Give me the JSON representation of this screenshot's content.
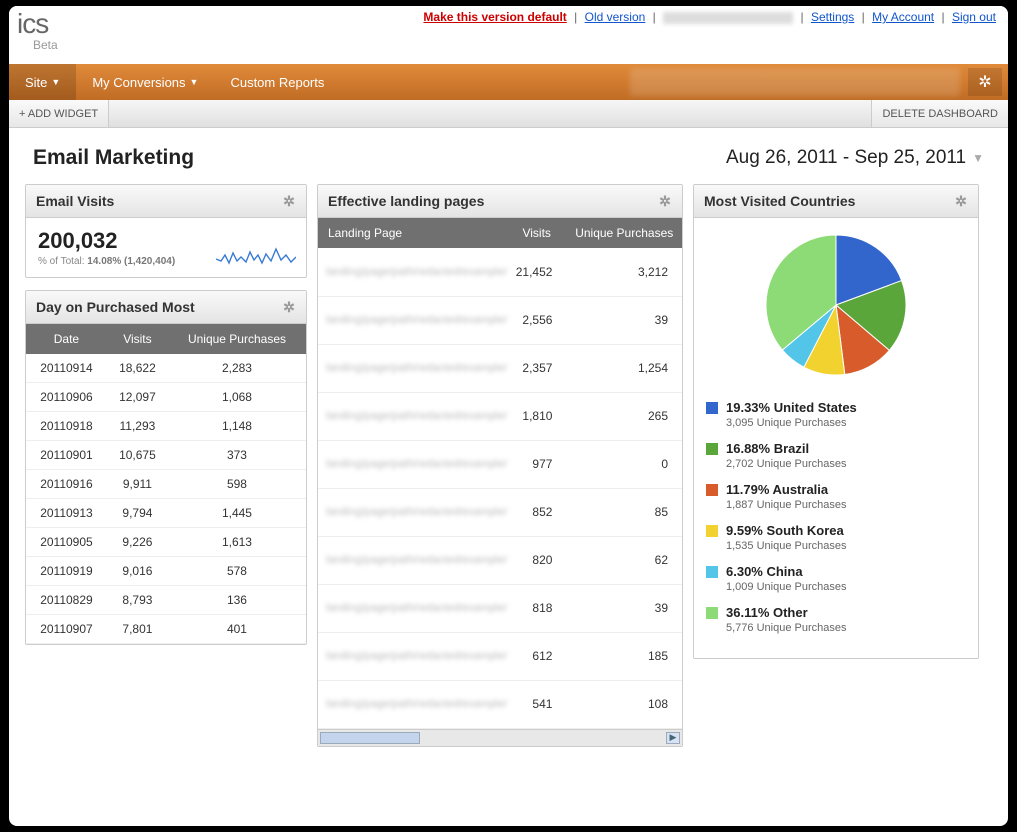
{
  "brand": {
    "suffix": "ics",
    "sub": "Beta"
  },
  "toplinks": {
    "default": "Make this version default",
    "old": "Old version",
    "settings": "Settings",
    "account": "My Account",
    "signout": "Sign out"
  },
  "nav": {
    "items": [
      {
        "label": "Site"
      },
      {
        "label": "My Conversions"
      },
      {
        "label": "Custom Reports"
      }
    ]
  },
  "toolbar": {
    "add": "+ ADD WIDGET",
    "delete": "DELETE DASHBOARD"
  },
  "page": {
    "title": "Email Marketing",
    "daterange": "Aug 26, 2011 - Sep 25, 2011"
  },
  "widgets": {
    "emailVisits": {
      "title": "Email Visits",
      "value": "200,032",
      "sub_prefix": "% of Total:",
      "sub_pct": "14.08%",
      "sub_total": "(1,420,404)"
    },
    "dayPurchased": {
      "title": "Day on Purchased Most",
      "cols": [
        "Date",
        "Visits",
        "Unique Purchases"
      ],
      "rows": [
        [
          "20110914",
          "18,622",
          "2,283"
        ],
        [
          "20110906",
          "12,097",
          "1,068"
        ],
        [
          "20110918",
          "11,293",
          "1,148"
        ],
        [
          "20110901",
          "10,675",
          "373"
        ],
        [
          "20110916",
          "9,911",
          "598"
        ],
        [
          "20110913",
          "9,794",
          "1,445"
        ],
        [
          "20110905",
          "9,226",
          "1,613"
        ],
        [
          "20110919",
          "9,016",
          "578"
        ],
        [
          "20110829",
          "8,793",
          "136"
        ],
        [
          "20110907",
          "7,801",
          "401"
        ]
      ]
    },
    "landing": {
      "title": "Effective landing pages",
      "cols": [
        "Landing Page",
        "Visits",
        "Unique Purchases"
      ],
      "rows": [
        [
          "",
          "21,452",
          "3,212"
        ],
        [
          "",
          "2,556",
          "39"
        ],
        [
          "",
          "2,357",
          "1,254"
        ],
        [
          "",
          "1,810",
          "265"
        ],
        [
          "",
          "977",
          "0"
        ],
        [
          "",
          "852",
          "85"
        ],
        [
          "",
          "820",
          "62"
        ],
        [
          "",
          "818",
          "39"
        ],
        [
          "",
          "612",
          "185"
        ],
        [
          "",
          "541",
          "108"
        ]
      ]
    },
    "countries": {
      "title": "Most Visited Countries",
      "items": [
        {
          "pct": "19.33%",
          "name": "United States",
          "sub": "3,095 Unique Purchases",
          "color": "#3366cc"
        },
        {
          "pct": "16.88%",
          "name": "Brazil",
          "sub": "2,702 Unique Purchases",
          "color": "#5aa63a"
        },
        {
          "pct": "11.79%",
          "name": "Australia",
          "sub": "1,887 Unique Purchases",
          "color": "#d85b2b"
        },
        {
          "pct": "9.59%",
          "name": "South Korea",
          "sub": "1,535 Unique Purchases",
          "color": "#f2d22e"
        },
        {
          "pct": "6.30%",
          "name": "China",
          "sub": "1,009 Unique Purchases",
          "color": "#53c5e8"
        },
        {
          "pct": "36.11%",
          "name": "Other",
          "sub": "5,776 Unique Purchases",
          "color": "#8ddb76"
        }
      ]
    }
  },
  "chart_data": {
    "type": "pie",
    "title": "Most Visited Countries",
    "series": [
      {
        "name": "United States",
        "value": 19.33,
        "unique_purchases": 3095,
        "color": "#3366cc"
      },
      {
        "name": "Brazil",
        "value": 16.88,
        "unique_purchases": 2702,
        "color": "#5aa63a"
      },
      {
        "name": "Australia",
        "value": 11.79,
        "unique_purchases": 1887,
        "color": "#d85b2b"
      },
      {
        "name": "South Korea",
        "value": 9.59,
        "unique_purchases": 1535,
        "color": "#f2d22e"
      },
      {
        "name": "China",
        "value": 6.3,
        "unique_purchases": 1009,
        "color": "#53c5e8"
      },
      {
        "name": "Other",
        "value": 36.11,
        "unique_purchases": 5776,
        "color": "#8ddb76"
      }
    ]
  }
}
